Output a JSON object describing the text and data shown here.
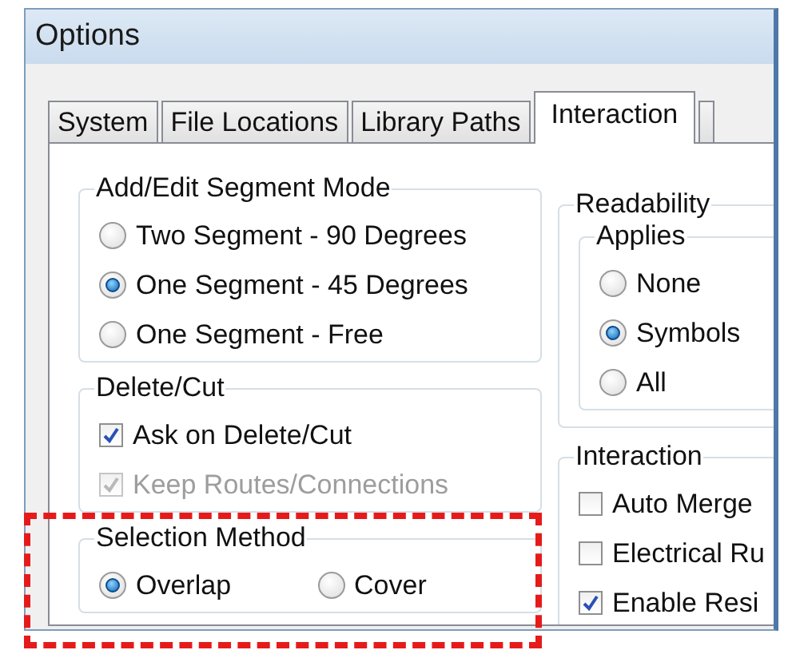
{
  "window": {
    "title": "Options"
  },
  "tabs": [
    {
      "label": "System",
      "selected": false
    },
    {
      "label": "File Locations",
      "selected": false
    },
    {
      "label": "Library Paths",
      "selected": false
    },
    {
      "label": "Interaction",
      "selected": true
    }
  ],
  "left_groups": [
    {
      "title": "Add/Edit Segment Mode",
      "kind": "stack",
      "items": [
        {
          "kind": "radio",
          "label": "Two Segment - 90 Degrees",
          "selected": false
        },
        {
          "kind": "radio",
          "label": "One Segment - 45 Degrees",
          "selected": true
        },
        {
          "kind": "radio",
          "label": "One Segment - Free",
          "selected": false
        }
      ]
    },
    {
      "title": "Delete/Cut",
      "kind": "stack",
      "items": [
        {
          "kind": "checkbox",
          "label": "Ask on Delete/Cut",
          "checked": true,
          "disabled": false
        },
        {
          "kind": "checkbox",
          "label": "Keep Routes/Connections",
          "checked": true,
          "disabled": true
        }
      ]
    },
    {
      "title": "Selection Method",
      "kind": "inline",
      "items": [
        {
          "kind": "radio",
          "label": "Overlap",
          "selected": true
        },
        {
          "kind": "radio",
          "label": "Cover",
          "selected": false
        }
      ]
    }
  ],
  "readability": {
    "title": "Readability",
    "applies": {
      "title": "Applies",
      "kind": "stack",
      "items": [
        {
          "kind": "radio",
          "label": "None",
          "selected": false
        },
        {
          "kind": "radio",
          "label": "Symbols",
          "selected": true
        },
        {
          "kind": "radio",
          "label": "All",
          "selected": false
        }
      ]
    }
  },
  "interaction": {
    "title": "Interaction",
    "kind": "stack",
    "items": [
      {
        "kind": "checkbox",
        "label": "Auto Merge",
        "checked": false,
        "disabled": false
      },
      {
        "kind": "checkbox",
        "label": "Electrical Ru",
        "checked": false,
        "disabled": false
      },
      {
        "kind": "checkbox",
        "label": "Enable Resi",
        "checked": true,
        "disabled": false
      }
    ]
  }
}
